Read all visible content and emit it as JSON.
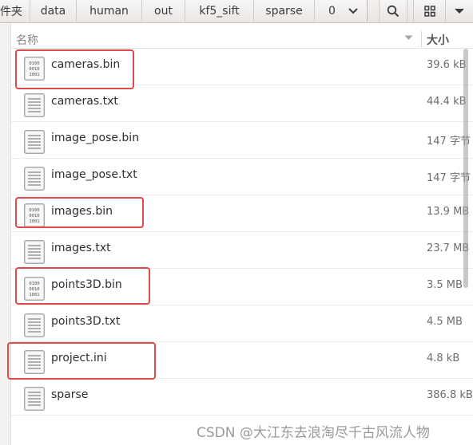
{
  "breadcrumbs": [
    {
      "label": "件夹"
    },
    {
      "label": "data"
    },
    {
      "label": "human"
    },
    {
      "label": "out"
    },
    {
      "label": "kf5_sift"
    },
    {
      "label": "sparse"
    },
    {
      "label": "0"
    }
  ],
  "header": {
    "dropdown_icon": "chevron-down-icon",
    "search_icon": "search-icon",
    "view_icon": "grid-view-icon",
    "menu_icon": "chevron-down-icon"
  },
  "columns": {
    "name": "名称",
    "size": "大小"
  },
  "files": [
    {
      "name": "cameras.bin",
      "size": "39.6 kB",
      "icon": "binary-file-icon",
      "highlighted": true
    },
    {
      "name": "cameras.txt",
      "size": "44.4 kB",
      "icon": "text-file-icon",
      "highlighted": false
    },
    {
      "name": "image_pose.bin",
      "size": "147 字节",
      "icon": "text-file-icon",
      "highlighted": false
    },
    {
      "name": "image_pose.txt",
      "size": "147 字节",
      "icon": "text-file-icon",
      "highlighted": false
    },
    {
      "name": "images.bin",
      "size": "13.9 MB",
      "icon": "binary-file-icon",
      "highlighted": true
    },
    {
      "name": "images.txt",
      "size": "23.7 MB",
      "icon": "text-file-icon",
      "highlighted": false
    },
    {
      "name": "points3D.bin",
      "size": "3.5 MB",
      "icon": "binary-file-icon",
      "highlighted": true
    },
    {
      "name": "points3D.txt",
      "size": "4.5 MB",
      "icon": "text-file-icon",
      "highlighted": false
    },
    {
      "name": "project.ini",
      "size": "4.8 kB",
      "icon": "text-file-icon",
      "highlighted": true
    },
    {
      "name": "sparse",
      "size": "386.8 kB",
      "icon": "text-file-icon",
      "highlighted": false
    }
  ],
  "watermark": "CSDN @大江东去浪淘尽千古风流人物",
  "colors": {
    "highlight": "#e04a4a",
    "header_bg": "#eceae8"
  }
}
